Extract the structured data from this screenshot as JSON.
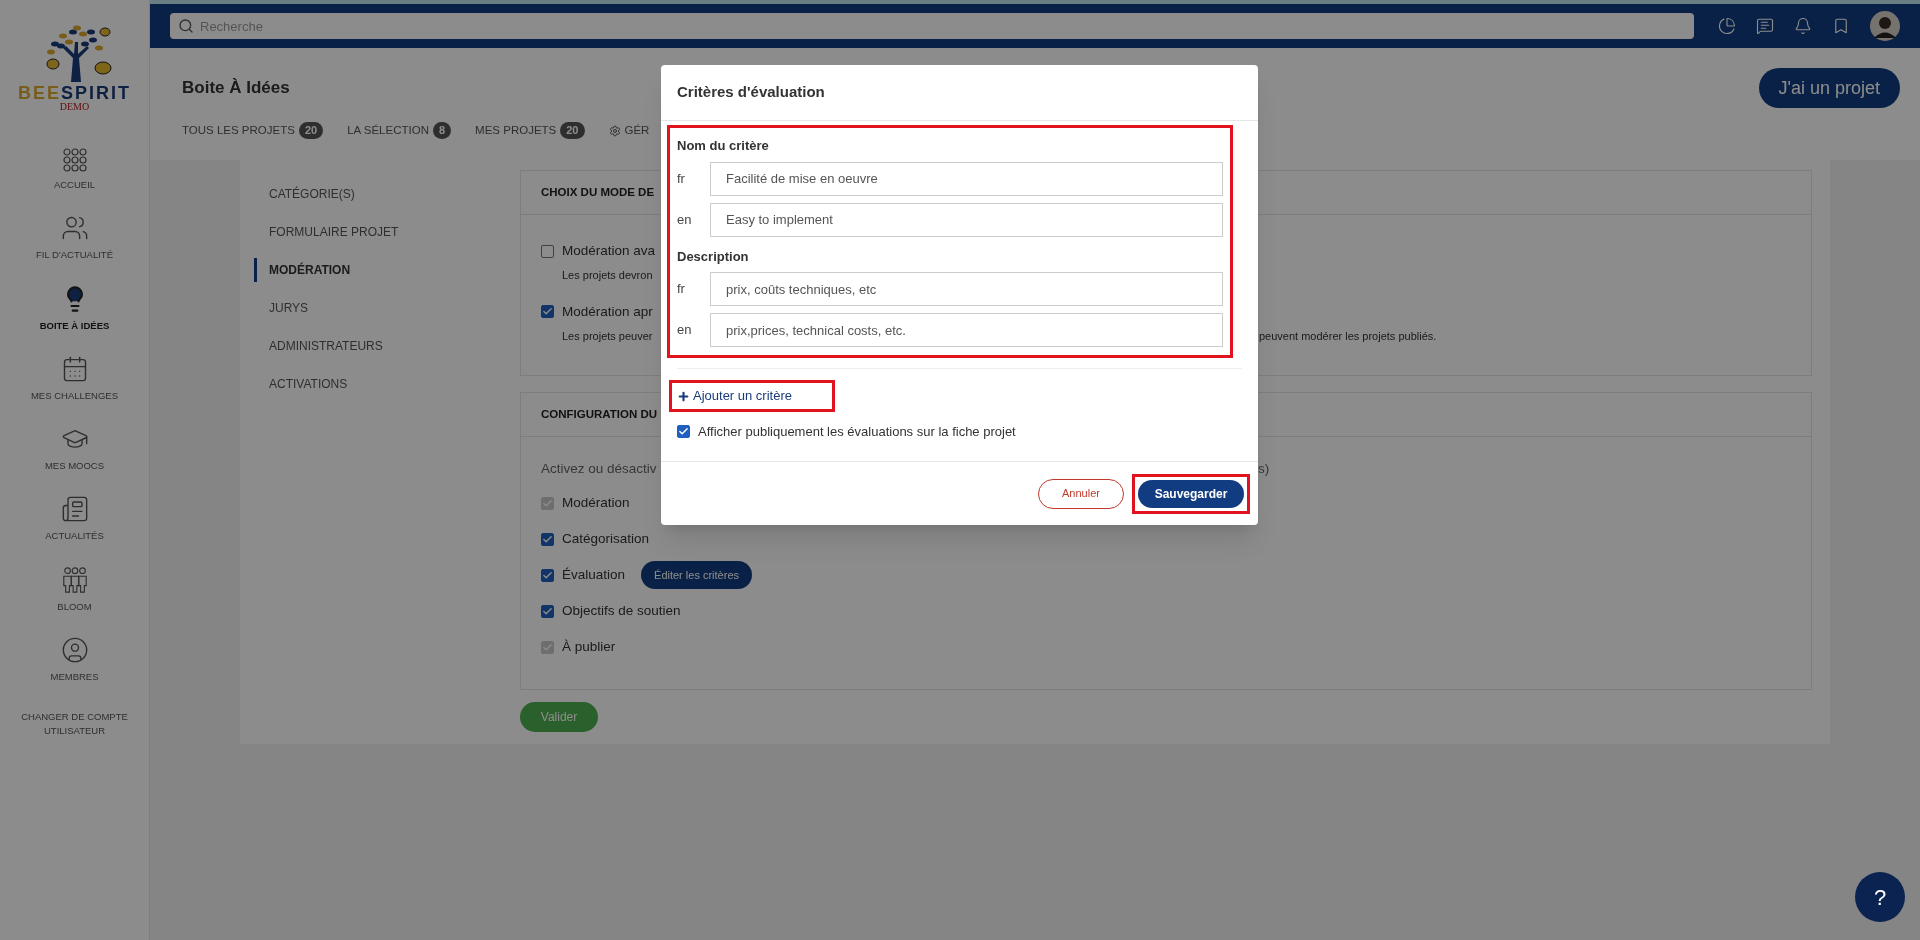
{
  "sidebar": {
    "logo": {
      "name": "BEESPIRIT",
      "tag": "DEMO"
    },
    "items": [
      {
        "label": "ACCUEIL",
        "kind": "grid",
        "selected": false
      },
      {
        "label": "FIL D'ACTUALITÉ",
        "kind": "people",
        "selected": false
      },
      {
        "label": "BOITE À IDÉES",
        "kind": "bulb",
        "selected": true
      },
      {
        "label": "MES CHALLENGES",
        "kind": "calendar",
        "selected": false
      },
      {
        "label": "MES MOOCS",
        "kind": "cap",
        "selected": false
      },
      {
        "label": "ACTUALITÉS",
        "kind": "news",
        "selected": false
      },
      {
        "label": "BLOOM",
        "kind": "group",
        "selected": false
      },
      {
        "label": "MEMBRES",
        "kind": "member",
        "selected": false
      }
    ],
    "account_link": "CHANGER DE COMPTE UTILISATEUR"
  },
  "topbar": {
    "search": {
      "placeholder": "Recherche"
    }
  },
  "page": {
    "title": "Boite À Idées",
    "action": "J'ai un projet",
    "tabs": [
      {
        "label": "TOUS LES PROJETS",
        "count": "20",
        "selected": false
      },
      {
        "label": "LA SÉLECTION",
        "count": "8",
        "selected": false
      },
      {
        "label": "MES PROJETS",
        "count": "20",
        "selected": false
      },
      {
        "label": "GÉR",
        "kind": "settings",
        "selected": false
      }
    ]
  },
  "settings_menu": [
    {
      "label": "CATÉGORIE(S)",
      "selected": false
    },
    {
      "label": "FORMULAIRE PROJET",
      "selected": false
    },
    {
      "label": "MODÉRATION",
      "selected": true
    },
    {
      "label": "JURYS",
      "selected": false
    },
    {
      "label": "ADMINISTRATEURS",
      "selected": false
    },
    {
      "label": "ACTIVATIONS",
      "selected": false
    }
  ],
  "moderation_card": {
    "title": "CHOIX DU MODE DE",
    "options": [
      {
        "label": "Modération ava",
        "checked": false,
        "note": "Les projets devron"
      },
      {
        "label": "Modération apr",
        "checked": true,
        "note": "Les projets peuver",
        "note_end": "peuvent modérer les projets publiés."
      }
    ]
  },
  "config_card": {
    "title": "CONFIGURATION DU",
    "intro": "Activez ou désactiv",
    "intro_end": "s)",
    "features": [
      {
        "label": "Modération",
        "checked": true,
        "disabled": true
      },
      {
        "label": "Catégorisation",
        "checked": true,
        "disabled": false
      },
      {
        "label": "Évaluation",
        "checked": true,
        "disabled": false,
        "action": "Éditer les critères"
      },
      {
        "label": "Objectifs de soutien",
        "checked": true,
        "disabled": false
      },
      {
        "label": "À publier",
        "checked": true,
        "disabled": true
      }
    ]
  },
  "submit": "Valider",
  "help": "?",
  "modal": {
    "title": "Critères d'évaluation",
    "groups": [
      {
        "label": "Nom du critère",
        "fields": [
          {
            "lang": "fr",
            "value": "Facilité de mise en oeuvre"
          },
          {
            "lang": "en",
            "value": "Easy to implement"
          }
        ]
      },
      {
        "label": "Description",
        "fields": [
          {
            "lang": "fr",
            "value": "prix, coûts techniques, etc"
          },
          {
            "lang": "en",
            "value": "prix,prices, technical costs, etc."
          }
        ]
      }
    ],
    "add_link": "Ajouter un critère",
    "public_option": {
      "label": "Afficher publiquement les évaluations sur la fiche projet",
      "checked": true
    },
    "buttons": [
      {
        "label": "Annuler",
        "kind": "secondary"
      },
      {
        "label": "Sauvegarder",
        "kind": "primary",
        "highlighted": true
      }
    ]
  }
}
